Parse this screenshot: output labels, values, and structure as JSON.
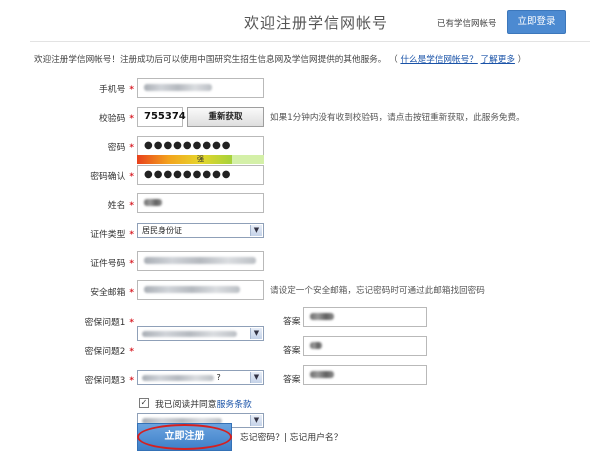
{
  "header": {
    "title": "欢迎注册学信网帐号",
    "have_account": "已有学信网帐号",
    "login_label": "立即登录"
  },
  "intro": {
    "text": "欢迎注册学信网帐号！注册成功后可以使用中国研究生招生信息网及学信网提供的其他服务。",
    "paren_open": "（",
    "link_what": "什么是学信网帐号？",
    "link_more": "了解更多",
    "paren_close": "）"
  },
  "fields": {
    "phone": {
      "label": "手机号",
      "req": "*"
    },
    "code": {
      "label": "校验码",
      "req": "*",
      "value": "755374",
      "refresh": "重新获取",
      "hint": "如果1分钟内没有收到校验码，请点击按钮重新获取，此服务免费。"
    },
    "password": {
      "label": "密码",
      "req": "*",
      "value": "●●●●●●●●●",
      "strength": "强"
    },
    "confirm": {
      "label": "密码确认",
      "req": "*",
      "value": "●●●●●●●●●"
    },
    "name": {
      "label": "姓名",
      "req": "*"
    },
    "idtype": {
      "label": "证件类型",
      "req": "*",
      "value": "居民身份证"
    },
    "idnum": {
      "label": "证件号码",
      "req": "*"
    },
    "email": {
      "label": "安全邮箱",
      "req": "*",
      "hint": "请设定一个安全邮箱，忘记密码时可通过此邮箱找回密码"
    },
    "q1": {
      "label": "密保问题1",
      "req": "*",
      "answer_label": "答案"
    },
    "q2": {
      "label": "密保问题2",
      "req": "*",
      "answer_label": "答案",
      "tail": "?"
    },
    "q3": {
      "label": "密保问题3",
      "req": "*",
      "answer_label": "答案"
    }
  },
  "agree": {
    "text": "我已阅读并同意",
    "link": "服务条款",
    "check": "✓"
  },
  "submit": {
    "label": "立即注册"
  },
  "forgot": {
    "text": "忘记密码？| 忘记用户名？"
  }
}
